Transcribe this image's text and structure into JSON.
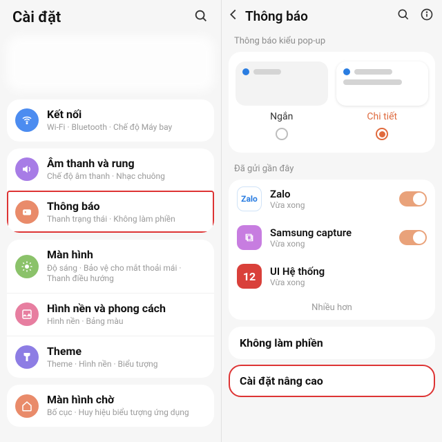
{
  "left": {
    "title": "Cài đặt",
    "rows": [
      {
        "id": "connections",
        "title": "Kết nối",
        "sub": "Wi-Fi · Bluetooth · Chế độ Máy bay",
        "color": "#4c8cf0"
      },
      {
        "id": "sound",
        "title": "Âm thanh và rung",
        "sub": "Chế độ âm thanh · Nhạc chuông",
        "color": "#a77ce6"
      },
      {
        "id": "notifications",
        "title": "Thông báo",
        "sub": "Thanh trạng thái · Không làm phiền",
        "color": "#e98b6a",
        "highlight": true
      },
      {
        "id": "display",
        "title": "Màn hình",
        "sub": "Độ sáng · Bảo vệ cho mắt thoải mái · Thanh điều hướng",
        "color": "#8bc26a"
      },
      {
        "id": "wallpaper",
        "title": "Hình nền và phong cách",
        "sub": "Hình nền · Bảng màu",
        "color": "#e77ea0"
      },
      {
        "id": "theme",
        "title": "Theme",
        "sub": "Theme · Hình nền · Biểu tượng",
        "color": "#8d7de4"
      },
      {
        "id": "homescreen",
        "title": "Màn hình chờ",
        "sub": "Bố cục · Huy hiệu biểu tượng ứng dụng",
        "color": "#e98b6a"
      }
    ]
  },
  "right": {
    "title": "Thông báo",
    "popup_section": "Thông báo kiểu pop-up",
    "styles": [
      {
        "id": "brief",
        "label": "Ngắn",
        "selected": false
      },
      {
        "id": "detailed",
        "label": "Chi tiết",
        "selected": true
      }
    ],
    "recent_section": "Đã gửi gần đây",
    "apps": [
      {
        "id": "zalo",
        "name": "Zalo",
        "sub": "Vừa xong",
        "color": "#2a7de1",
        "toggle": true,
        "glyph": "Zalo"
      },
      {
        "id": "samsungcapture",
        "name": "Samsung capture",
        "sub": "Vừa xong",
        "color": "#c77de0",
        "toggle": true,
        "glyph": "⧉"
      },
      {
        "id": "systemui",
        "name": "UI Hệ thống",
        "sub": "Vừa xong",
        "color": "#d9403a",
        "toggle": false,
        "glyph": "12"
      }
    ],
    "more": "Nhiều hơn",
    "dnd": "Không làm phiền",
    "advanced": "Cài đặt nâng cao"
  }
}
